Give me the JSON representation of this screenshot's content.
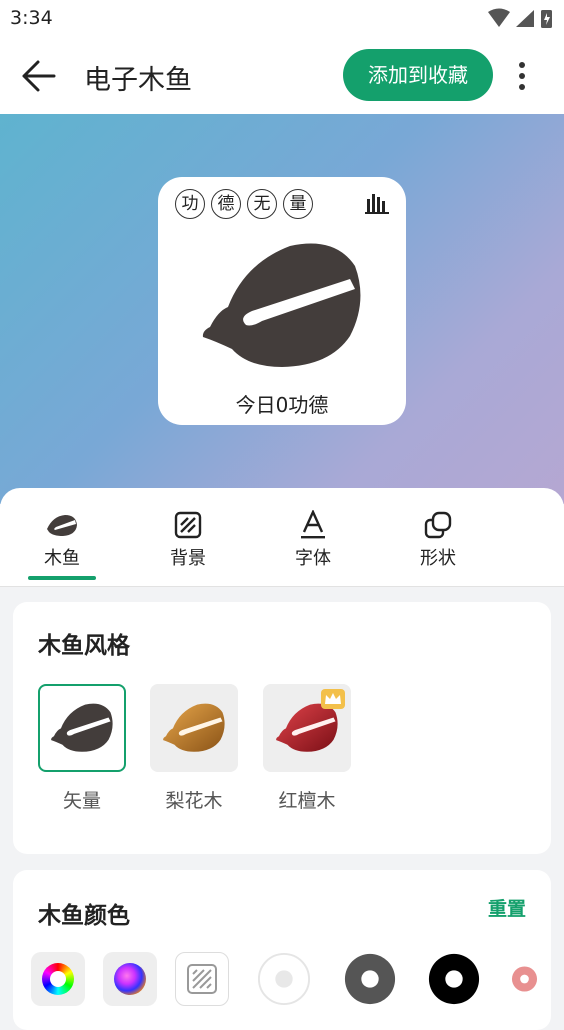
{
  "status_bar": {
    "time": "3:34"
  },
  "app_bar": {
    "title": "电子木鱼",
    "favorite_button": "添加到收藏"
  },
  "preview": {
    "chips": [
      "功",
      "德",
      "无",
      "量"
    ],
    "merit_text": "今日0功德"
  },
  "tabs": [
    {
      "label": "木鱼",
      "icon": "fish-icon",
      "active": true
    },
    {
      "label": "背景",
      "icon": "background-pattern-icon",
      "active": false
    },
    {
      "label": "字体",
      "icon": "font-icon",
      "active": false
    },
    {
      "label": "形状",
      "icon": "shape-icon",
      "active": false
    }
  ],
  "style_section": {
    "title": "木鱼风格",
    "options": [
      {
        "label": "矢量",
        "selected": true
      },
      {
        "label": "梨花木",
        "selected": false
      },
      {
        "label": "红檀木",
        "selected": false,
        "badge": "crown-icon"
      }
    ]
  },
  "color_section": {
    "title": "木鱼颜色",
    "reset_label": "重置",
    "swatches": [
      "color-wheel-icon",
      "palette-icon",
      "texture-icon",
      "#ffffff",
      "#555555",
      "#000000",
      "#e89090"
    ]
  },
  "colors": {
    "accent": "#14a06c",
    "fish": "#433d3b"
  }
}
